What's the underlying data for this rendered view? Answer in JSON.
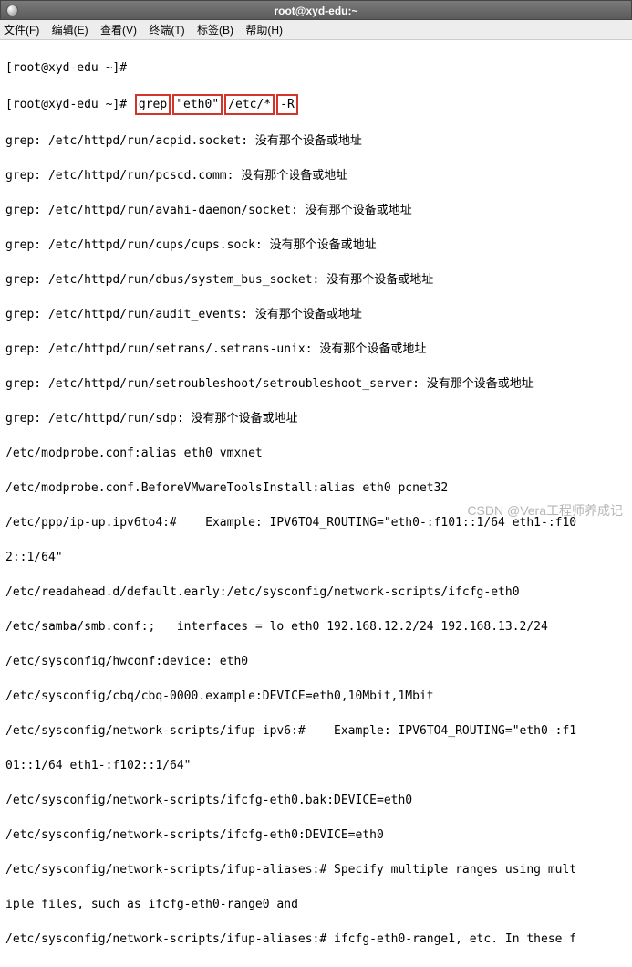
{
  "window": {
    "title": "root@xyd-edu:~"
  },
  "menu": {
    "file": "文件(F)",
    "edit": "编辑(E)",
    "view": "查看(V)",
    "terminal": "终端(T)",
    "tabs": "标签(B)",
    "help": "帮助(H)"
  },
  "prompt": "[root@xyd-edu ~]#",
  "cmd": {
    "grep": "grep",
    "pattern": "\"eth0\"",
    "dir": "/etc/*",
    "flag": "-R"
  },
  "errors": {
    "e1": "grep: /etc/httpd/run/acpid.socket: 没有那个设备或地址",
    "e2": "grep: /etc/httpd/run/pcscd.comm: 没有那个设备或地址",
    "e3": "grep: /etc/httpd/run/avahi-daemon/socket: 没有那个设备或地址",
    "e4": "grep: /etc/httpd/run/cups/cups.sock: 没有那个设备或地址",
    "e5": "grep: /etc/httpd/run/dbus/system_bus_socket: 没有那个设备或地址",
    "e6": "grep: /etc/httpd/run/audit_events: 没有那个设备或地址",
    "e7": "grep: /etc/httpd/run/setrans/.setrans-unix: 没有那个设备或地址",
    "e8": "grep: /etc/httpd/run/setroubleshoot/setroubleshoot_server: 没有那个设备或地址",
    "e9": "grep: /etc/httpd/run/sdp: 没有那个设备或地址"
  },
  "out": {
    "l1": "/etc/modprobe.conf:alias eth0 vmxnet",
    "l2": "/etc/modprobe.conf.BeforeVMwareToolsInstall:alias eth0 pcnet32",
    "l3a": "/etc/ppp/ip-up.ipv6to4:#    Example: IPV6TO4_ROUTING=\"eth0-:f101::1/64 eth1-:f10",
    "l3b": "2::1/64\"",
    "l4": "/etc/readahead.d/default.early:/etc/sysconfig/network-scripts/ifcfg-eth0",
    "l5": "/etc/samba/smb.conf:;   interfaces = lo eth0 192.168.12.2/24 192.168.13.2/24",
    "l6": "/etc/sysconfig/hwconf:device: eth0",
    "l7": "/etc/sysconfig/cbq/cbq-0000.example:DEVICE=eth0,10Mbit,1Mbit",
    "l8a": "/etc/sysconfig/network-scripts/ifup-ipv6:#    Example: IPV6TO4_ROUTING=\"eth0-:f1",
    "l8b": "01::1/64 eth1-:f102::1/64\"",
    "l9": "/etc/sysconfig/network-scripts/ifcfg-eth0.bak:DEVICE=eth0",
    "l10": "/etc/sysconfig/network-scripts/ifcfg-eth0:DEVICE=eth0",
    "l11a": "/etc/sysconfig/network-scripts/ifup-aliases:# Specify multiple ranges using mult",
    "l11b": "iple files, such as ifcfg-eth0-range0 and",
    "l12": "/etc/sysconfig/network-scripts/ifup-aliases:# ifcfg-eth0-range1, etc. In these f"
  },
  "watermark": "CSDN @Vera工程师养成记"
}
